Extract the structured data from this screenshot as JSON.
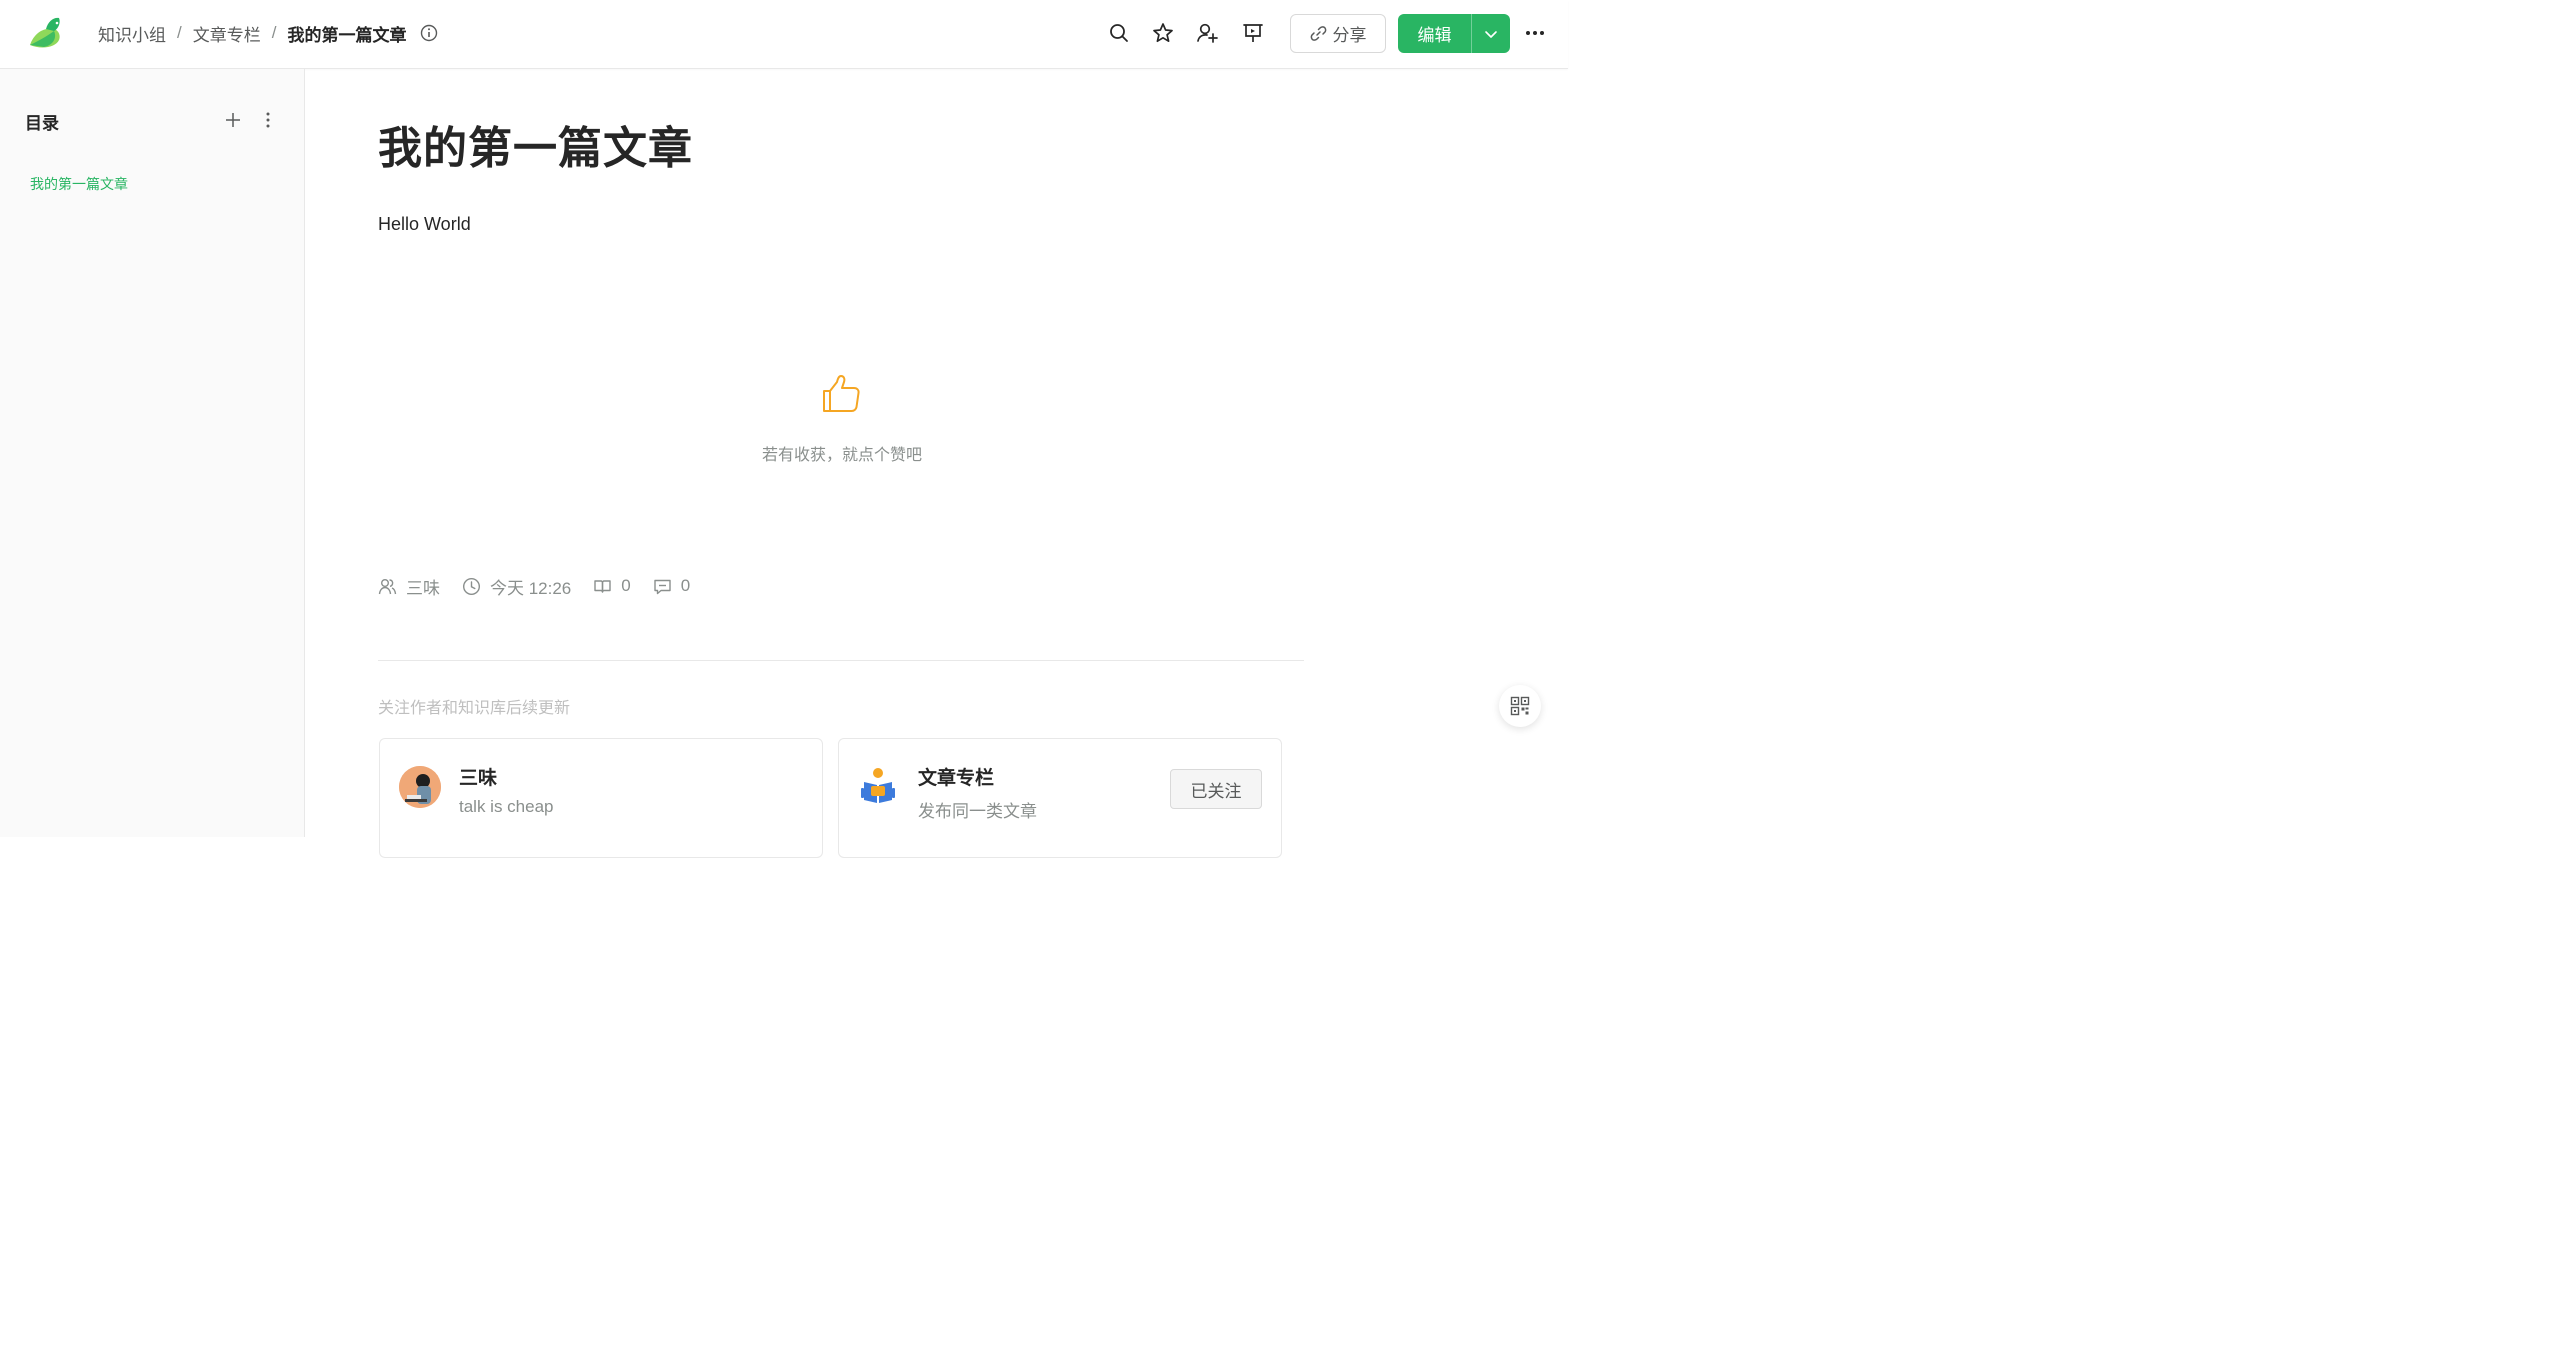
{
  "header": {
    "breadcrumb": [
      "知识小组",
      "文章专栏",
      "我的第一篇文章"
    ],
    "separator": "/",
    "share_label": "分享",
    "edit_label": "编辑",
    "icons": [
      "search-icon",
      "star-icon",
      "add-user-icon",
      "present-icon",
      "link-icon",
      "chevron-down-icon",
      "more-icon"
    ],
    "accent_color": "#29b563"
  },
  "sidebar": {
    "title": "目录",
    "items": [
      {
        "label": "我的第一篇文章",
        "active": true
      }
    ]
  },
  "doc": {
    "title": "我的第一篇文章",
    "body": "Hello World",
    "like_prompt": "若有收获，就点个赞吧"
  },
  "meta": {
    "author": "三味",
    "time": "今天 12:26",
    "reads": "0",
    "comments": "0"
  },
  "follow": {
    "hint": "关注作者和知识库后续更新",
    "author_card": {
      "name": "三味",
      "bio": "talk is cheap"
    },
    "book_card": {
      "name": "文章专栏",
      "desc": "发布同一类文章",
      "button": "已关注"
    }
  }
}
